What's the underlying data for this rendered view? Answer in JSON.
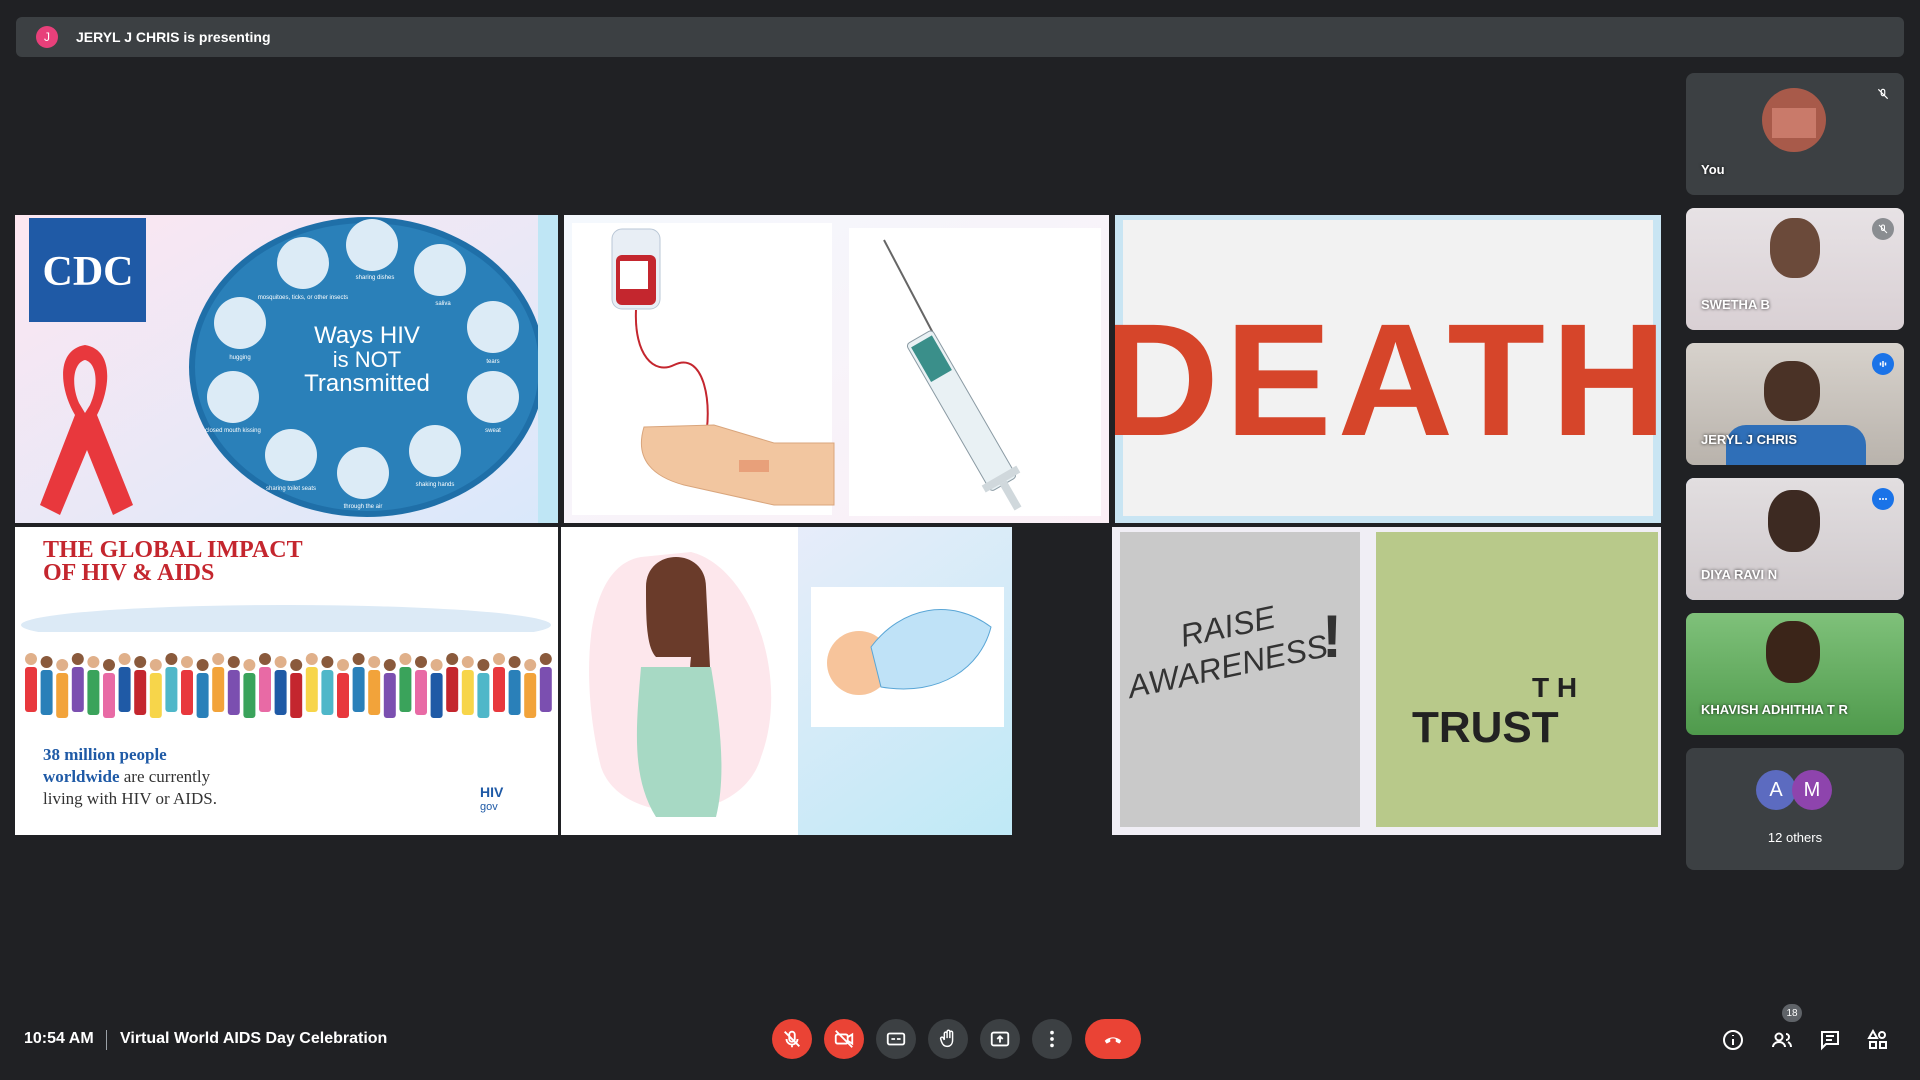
{
  "banner": {
    "avatar_letter": "J",
    "text": "JERYL J CHRIS is presenting"
  },
  "slides": {
    "cdc": {
      "logo": "CDC",
      "circle_title_1": "Ways HIV",
      "circle_title_2": "is NOT",
      "circle_title_3": "Transmitted",
      "labels": [
        "mosquitoes, ticks, or other insects",
        "sharing dishes",
        "saliva",
        "hugging",
        "tears",
        "closed mouth kissing",
        "sweat",
        "sharing toilet seats",
        "through the air",
        "shaking hands"
      ]
    },
    "death": {
      "word": "DEATH"
    },
    "impact": {
      "title_1": "THE GLOBAL IMPACT",
      "title_2": "OF HIV & AIDS",
      "stat_bold_1": "38 million people",
      "stat_bold_2": "worldwide",
      "stat_rest_1": " are currently",
      "stat_rest_2": "living with HIV or AIDS.",
      "logo_1": "HIV",
      "logo_2": "gov"
    },
    "awareness": {
      "line_1": "RAISE",
      "line_2": "AWARENESS",
      "exclaim": "!",
      "trust_top": "T H",
      "trust_bottom": "TRUST"
    }
  },
  "participants": [
    {
      "name": "You",
      "badge": "mic-off-icon"
    },
    {
      "name": "SWETHA B",
      "badge": "mic-off-icon"
    },
    {
      "name": "JERYL J CHRIS",
      "badge": "speaking-icon"
    },
    {
      "name": "DIYA RAVI N",
      "badge": "more-icon"
    },
    {
      "name": "KHAVISH ADHITHIA T R"
    }
  ],
  "others": {
    "avatar_1": "A",
    "avatar_2": "M",
    "label": "12 others"
  },
  "bottombar": {
    "time": "10:54 AM",
    "meeting_name": "Virtual World AIDS Day Celebration",
    "people_count": "18"
  },
  "colors": {
    "end_call": "#ea4335",
    "accent": "#8ab4f8",
    "background": "#202124"
  }
}
